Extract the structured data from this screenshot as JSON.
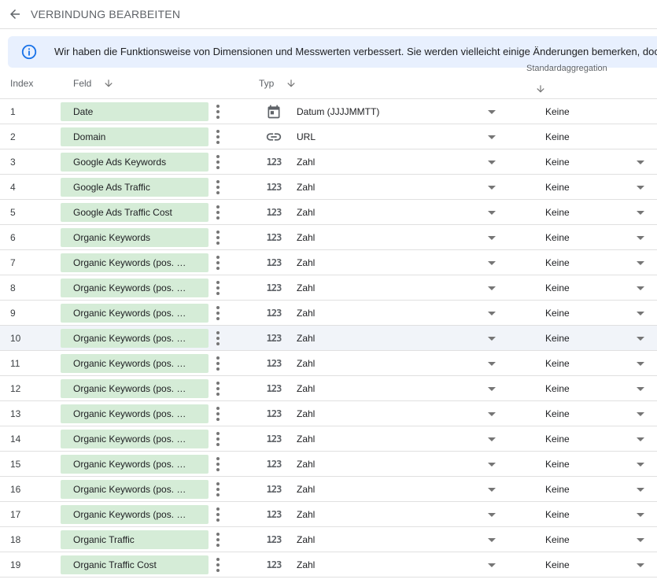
{
  "header": {
    "title": "VERBINDUNG BEARBEITEN",
    "back_icon": "arrow-back-icon"
  },
  "banner": {
    "icon": "info-icon",
    "text": "Wir haben die Funktionsweise von Dimensionen und Messwerten verbessert. Sie werden vielleicht einige Änderungen bemerken, doch"
  },
  "columns": {
    "index": "Index",
    "field": "Feld",
    "type": "Typ",
    "aggregation": "Standardaggregation"
  },
  "colors": {
    "chip_bg": "#d5ecd7",
    "banner_bg": "#e8f0fe",
    "info_blue": "#1a73e8",
    "highlight_row": "#f1f4f9"
  },
  "rows": [
    {
      "index": "1",
      "field": "Date",
      "type_icon": "calendar-icon",
      "type": "Datum (JJJJMMTT)",
      "aggregation": "Keine",
      "agg_dropdown": false
    },
    {
      "index": "2",
      "field": "Domain",
      "type_icon": "link-icon",
      "type": "URL",
      "aggregation": "Keine",
      "agg_dropdown": false
    },
    {
      "index": "3",
      "field": "Google Ads Keywords",
      "type_icon": "number-icon",
      "type": "Zahl",
      "aggregation": "Keine",
      "agg_dropdown": true
    },
    {
      "index": "4",
      "field": "Google Ads Traffic",
      "type_icon": "number-icon",
      "type": "Zahl",
      "aggregation": "Keine",
      "agg_dropdown": true
    },
    {
      "index": "5",
      "field": "Google Ads Traffic Cost",
      "type_icon": "number-icon",
      "type": "Zahl",
      "aggregation": "Keine",
      "agg_dropdown": true
    },
    {
      "index": "6",
      "field": "Organic Keywords",
      "type_icon": "number-icon",
      "type": "Zahl",
      "aggregation": "Keine",
      "agg_dropdown": true
    },
    {
      "index": "7",
      "field": "Organic Keywords (pos. …",
      "type_icon": "number-icon",
      "type": "Zahl",
      "aggregation": "Keine",
      "agg_dropdown": true
    },
    {
      "index": "8",
      "field": "Organic Keywords (pos. …",
      "type_icon": "number-icon",
      "type": "Zahl",
      "aggregation": "Keine",
      "agg_dropdown": true
    },
    {
      "index": "9",
      "field": "Organic Keywords (pos. …",
      "type_icon": "number-icon",
      "type": "Zahl",
      "aggregation": "Keine",
      "agg_dropdown": true
    },
    {
      "index": "10",
      "field": "Organic Keywords (pos. …",
      "type_icon": "number-icon",
      "type": "Zahl",
      "aggregation": "Keine",
      "agg_dropdown": true,
      "highlighted": true
    },
    {
      "index": "11",
      "field": "Organic Keywords (pos. …",
      "type_icon": "number-icon",
      "type": "Zahl",
      "aggregation": "Keine",
      "agg_dropdown": true
    },
    {
      "index": "12",
      "field": "Organic Keywords (pos. …",
      "type_icon": "number-icon",
      "type": "Zahl",
      "aggregation": "Keine",
      "agg_dropdown": true
    },
    {
      "index": "13",
      "field": "Organic Keywords (pos. …",
      "type_icon": "number-icon",
      "type": "Zahl",
      "aggregation": "Keine",
      "agg_dropdown": true
    },
    {
      "index": "14",
      "field": "Organic Keywords (pos. …",
      "type_icon": "number-icon",
      "type": "Zahl",
      "aggregation": "Keine",
      "agg_dropdown": true
    },
    {
      "index": "15",
      "field": "Organic Keywords (pos. …",
      "type_icon": "number-icon",
      "type": "Zahl",
      "aggregation": "Keine",
      "agg_dropdown": true
    },
    {
      "index": "16",
      "field": "Organic Keywords (pos. …",
      "type_icon": "number-icon",
      "type": "Zahl",
      "aggregation": "Keine",
      "agg_dropdown": true
    },
    {
      "index": "17",
      "field": "Organic Keywords (pos. …",
      "type_icon": "number-icon",
      "type": "Zahl",
      "aggregation": "Keine",
      "agg_dropdown": true
    },
    {
      "index": "18",
      "field": "Organic Traffic",
      "type_icon": "number-icon",
      "type": "Zahl",
      "aggregation": "Keine",
      "agg_dropdown": true
    },
    {
      "index": "19",
      "field": "Organic Traffic Cost",
      "type_icon": "number-icon",
      "type": "Zahl",
      "aggregation": "Keine",
      "agg_dropdown": true
    }
  ]
}
